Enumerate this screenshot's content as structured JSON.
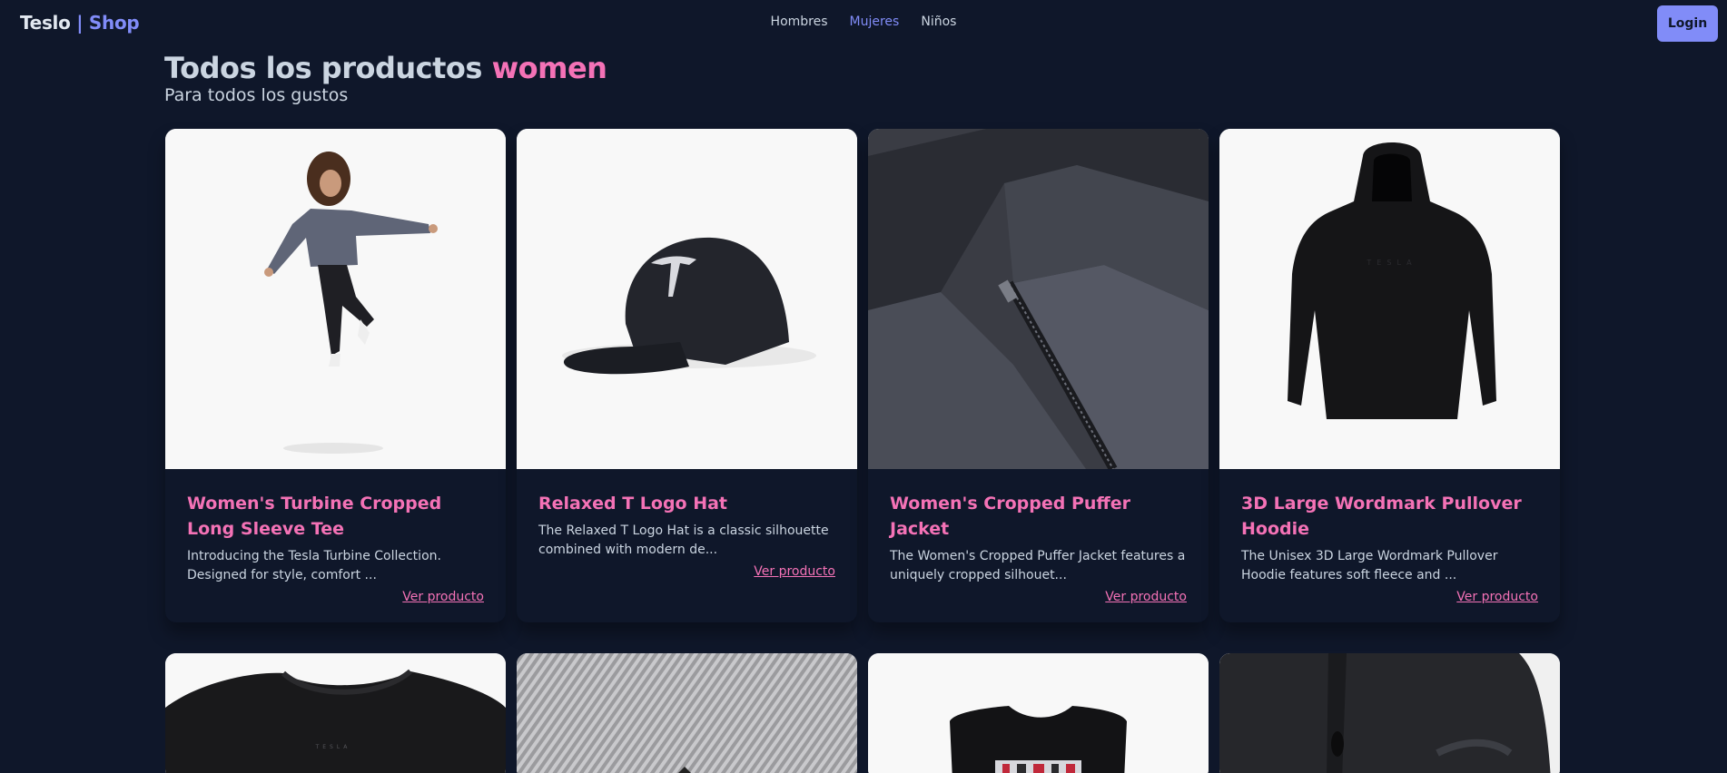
{
  "nav": {
    "brand_main": "Teslo",
    "brand_sep": " | ",
    "brand_accent": "Shop",
    "links": [
      "Hombres",
      "Mujeres",
      "Niños"
    ],
    "active_link": "Mujeres",
    "login_label": "Login"
  },
  "page": {
    "title_prefix": "Todos los productos",
    "title_accent": "women",
    "subtitle": "Para todos los gustos"
  },
  "products": [
    {
      "name": "Women's Turbine Cropped Long Sleeve Tee",
      "description": "Introducing the Tesla Turbine Collection. Designed for style, comfort ...",
      "link": "Ver producto"
    },
    {
      "name": "Relaxed T Logo Hat",
      "description": "The Relaxed T Logo Hat is a classic silhouette combined with modern de...",
      "link": "Ver producto"
    },
    {
      "name": "Women's Cropped Puffer Jacket",
      "description": "The Women's Cropped Puffer Jacket features a uniquely cropped silhouet...",
      "link": "Ver producto"
    },
    {
      "name": "3D Large Wordmark Pullover Hoodie",
      "description": "The Unisex 3D Large Wordmark Pullover Hoodie features soft fleece and ...",
      "link": "Ver producto"
    }
  ],
  "colors": {
    "background": "#0f172a",
    "accent_pink": "#f472b6",
    "accent_indigo": "#818cf8"
  }
}
